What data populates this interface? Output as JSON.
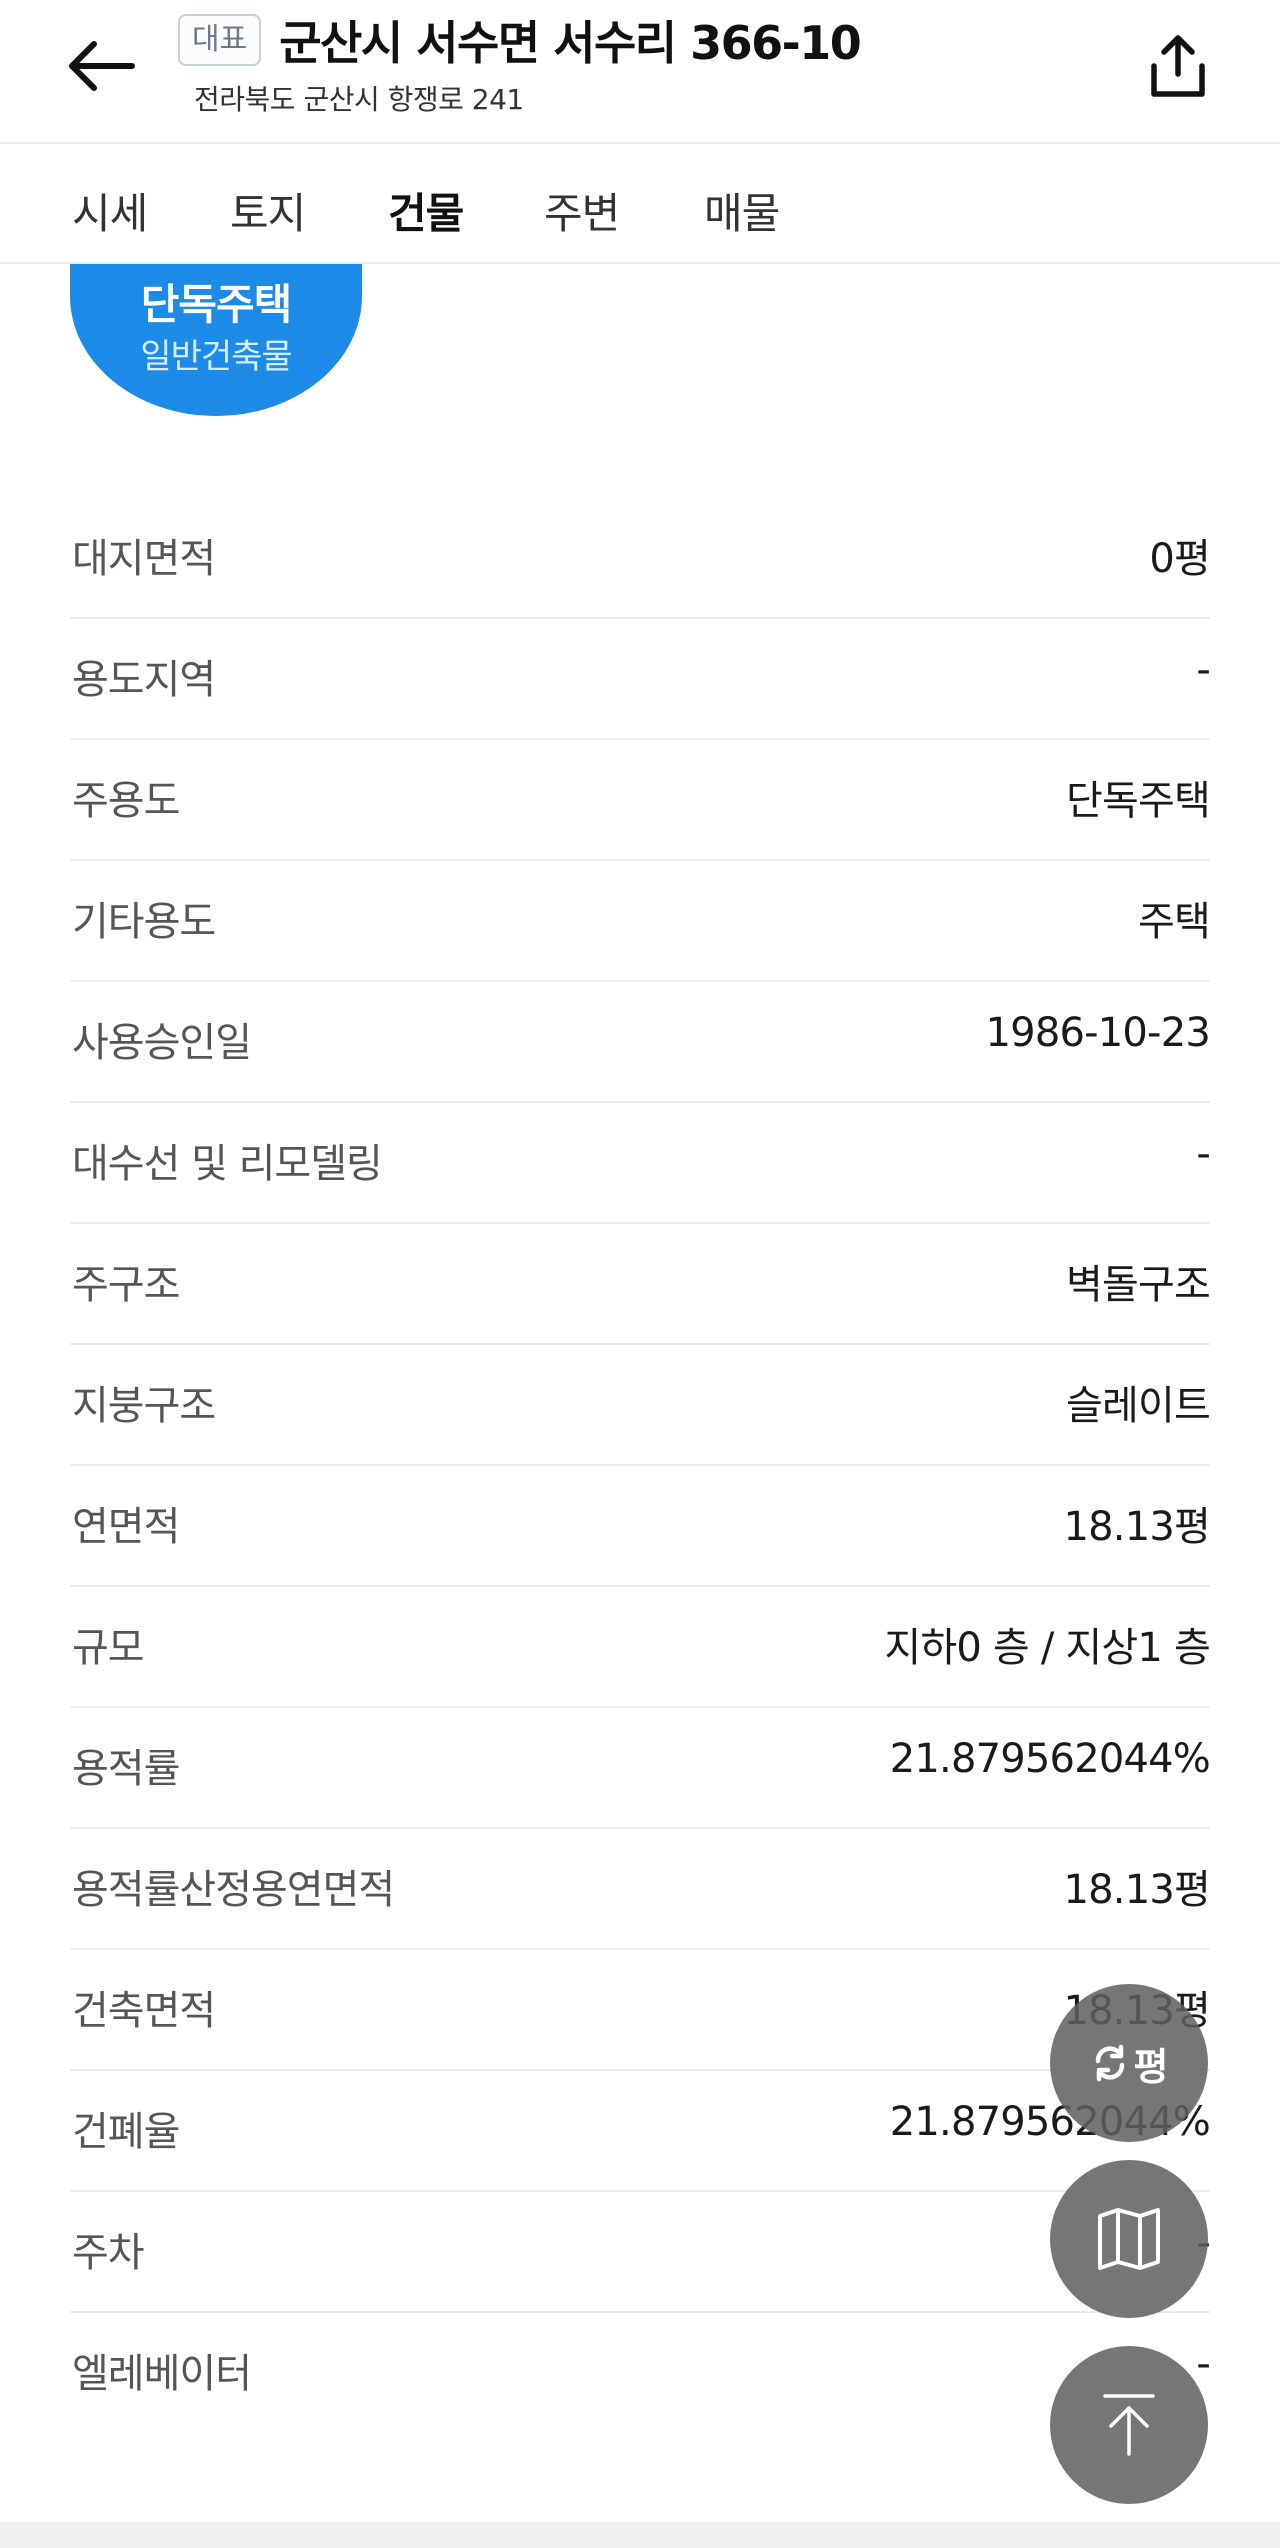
{
  "header": {
    "badge": "대표",
    "title": "군산시 서수면 서수리 366-10",
    "subtitle": "전라북도 군산시 항쟁로 241"
  },
  "tabs": [
    {
      "label": "시세",
      "active": false
    },
    {
      "label": "토지",
      "active": false
    },
    {
      "label": "건물",
      "active": true
    },
    {
      "label": "주변",
      "active": false
    },
    {
      "label": "매물",
      "active": false
    }
  ],
  "building_type": {
    "main": "단독주택",
    "sub": "일반건축물",
    "color": "#1b8be7"
  },
  "info": [
    {
      "label": "대지면적",
      "value": "0평"
    },
    {
      "label": "용도지역",
      "value": "-"
    },
    {
      "label": "주용도",
      "value": "단독주택"
    },
    {
      "label": "기타용도",
      "value": "주택"
    },
    {
      "label": "사용승인일",
      "value": "1986-10-23"
    },
    {
      "label": "대수선 및 리모델링",
      "value": "-"
    },
    {
      "label": "주구조",
      "value": "벽돌구조"
    },
    {
      "label": "지붕구조",
      "value": "슬레이트"
    },
    {
      "label": "연면적",
      "value": "18.13평"
    },
    {
      "label": "규모",
      "value": "지하0 층 / 지상1 층"
    },
    {
      "label": "용적률",
      "value": "21.879562044%"
    },
    {
      "label": "용적률산정용연면적",
      "value": "18.13평"
    },
    {
      "label": "건축면적",
      "value": "18.13평"
    },
    {
      "label": "건폐율",
      "value": "21.879562044%"
    },
    {
      "label": "주차",
      "value": "-"
    },
    {
      "label": "엘레베이터",
      "value": "-"
    }
  ],
  "fab": {
    "unit_label": "평",
    "icons": [
      "swap-unit-icon",
      "map-icon",
      "scroll-top-icon"
    ]
  }
}
